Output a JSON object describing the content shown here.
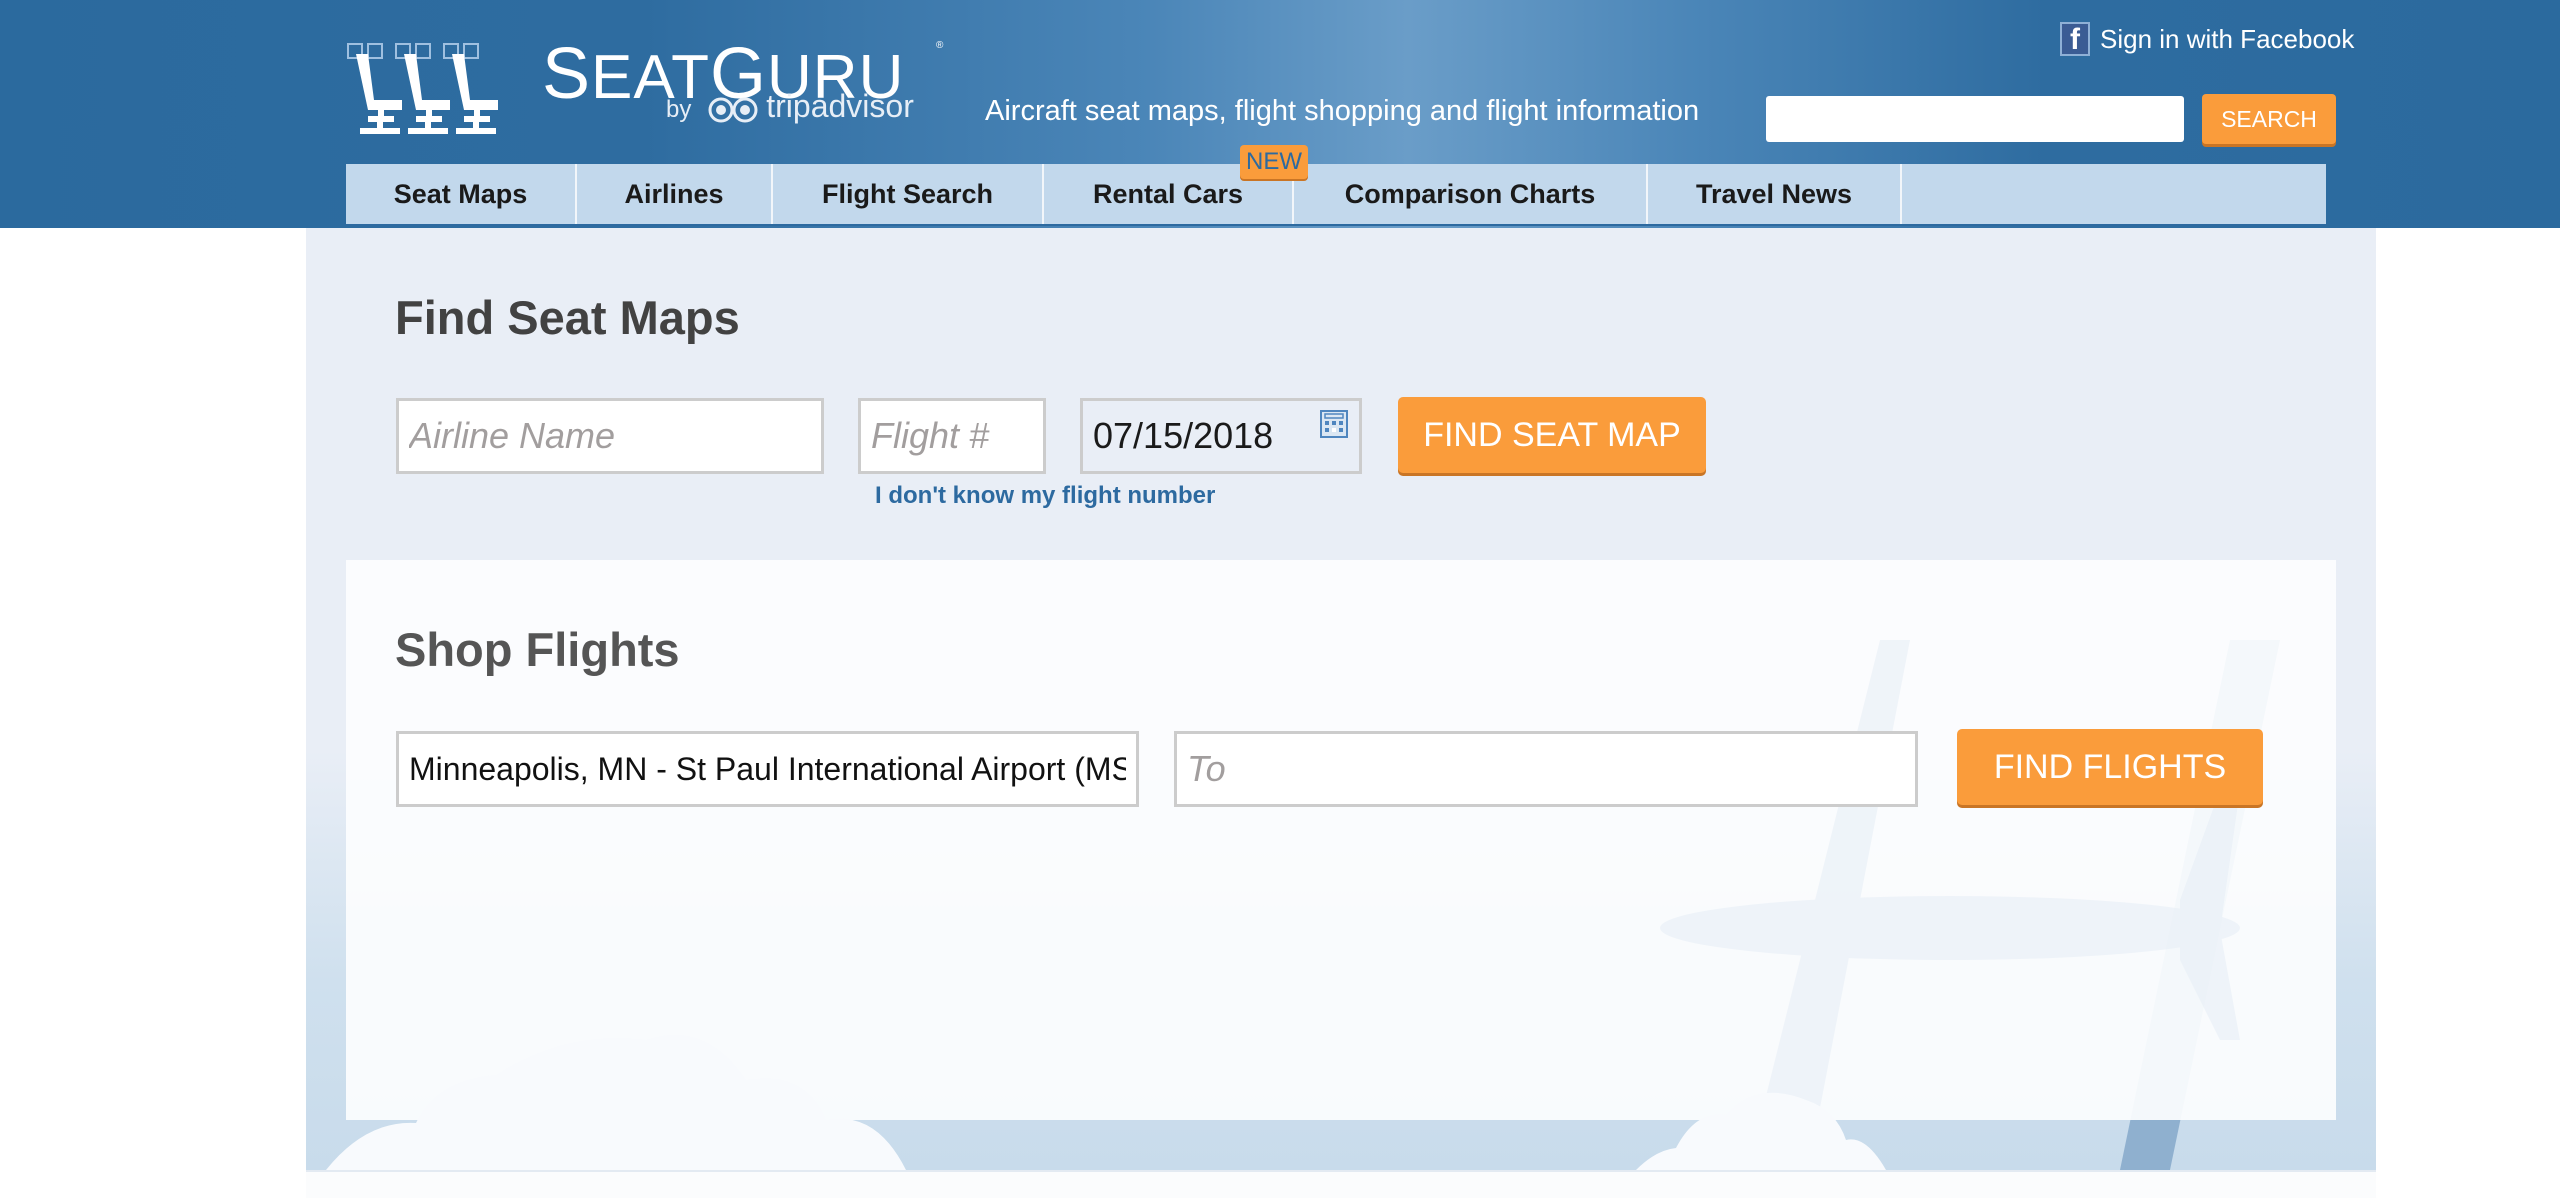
{
  "header": {
    "logo_text_first": "S",
    "logo_text_rest1": "EAT",
    "logo_text_g": "G",
    "logo_text_rest2": "URU",
    "logo_by": "by",
    "logo_partner": "tripadvisor",
    "tagline": "Aircraft seat maps, flight shopping and flight information",
    "facebook_signin": "Sign in with Facebook",
    "search": {
      "value": "",
      "placeholder": "",
      "button_label": "SEARCH"
    }
  },
  "nav": {
    "items": [
      {
        "label": "Seat Maps"
      },
      {
        "label": "Airlines"
      },
      {
        "label": "Flight Search"
      },
      {
        "label": "Rental Cars",
        "badge": "NEW"
      },
      {
        "label": "Comparison Charts"
      },
      {
        "label": "Travel News"
      }
    ]
  },
  "find_seat_maps": {
    "title": "Find Seat Maps",
    "airline": {
      "value": "",
      "placeholder": "Airline Name"
    },
    "flight_number": {
      "value": "",
      "placeholder": "Flight #"
    },
    "date": {
      "value": "07/15/2018"
    },
    "calendar_icon": "calendar-icon",
    "button_label": "FIND SEAT MAP",
    "help_link": "I don't know my flight number"
  },
  "shop_flights": {
    "title": "Shop Flights",
    "from": {
      "value": "Minneapolis, MN - St Paul International Airport (MSP)",
      "placeholder": ""
    },
    "to": {
      "value": "",
      "placeholder": "To"
    },
    "button_label": "FIND FLIGHTS"
  },
  "colors": {
    "header_blue": "#2b6a9e",
    "nav_bg": "#c2d8ec",
    "accent_orange": "#fa9c3b",
    "link_blue": "#2d6aa0",
    "panel_bg": "#e9eef6"
  }
}
